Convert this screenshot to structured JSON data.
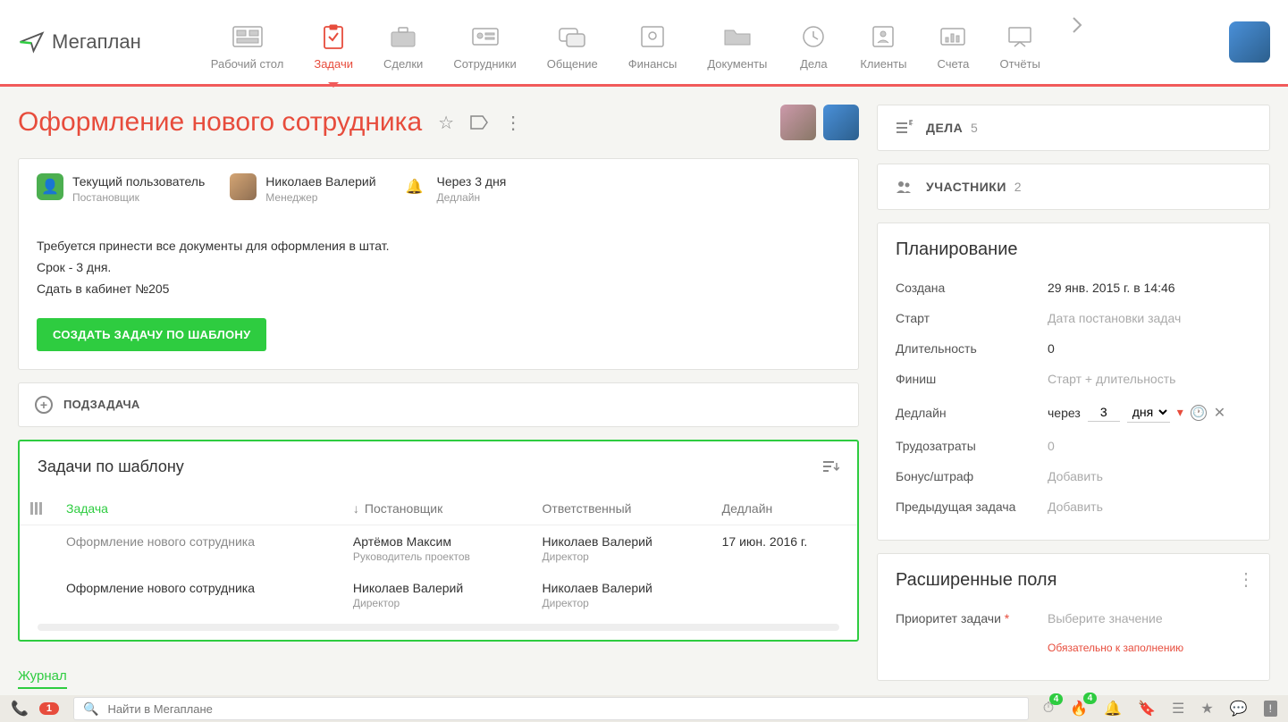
{
  "logo_text": "егаплан",
  "nav": [
    {
      "label": "Рабочий стол"
    },
    {
      "label": "Задачи"
    },
    {
      "label": "Сделки"
    },
    {
      "label": "Сотрудники"
    },
    {
      "label": "Общение"
    },
    {
      "label": "Финансы"
    },
    {
      "label": "Документы"
    },
    {
      "label": "Дела"
    },
    {
      "label": "Клиенты"
    },
    {
      "label": "Счета"
    },
    {
      "label": "Отчёты"
    }
  ],
  "page_title": "Оформление нового сотрудника",
  "task_header": {
    "owner": {
      "name": "Текущий пользователь",
      "role": "Постановщик"
    },
    "manager": {
      "name": "Николаев Валерий",
      "role": "Менеджер"
    },
    "deadline": {
      "value": "Через 3 дня",
      "label": "Дедлайн"
    }
  },
  "task_desc": {
    "l1": "Требуется принести все документы для оформления в штат.",
    "l2": "Срок - 3 дня.",
    "l3": "Сдать в кабинет №205"
  },
  "btn_create": "СОЗДАТЬ ЗАДАЧУ ПО ШАБЛОНУ",
  "subtask_label": "ПОДЗАДАЧА",
  "template": {
    "title": "Задачи по шаблону",
    "cols": {
      "task": "Задача",
      "setter": "Постановщик",
      "resp": "Ответственный",
      "deadline": "Дедлайн"
    },
    "rows": [
      {
        "task": "Оформление нового сотрудника",
        "setter": "Артёмов Максим",
        "setter_role": "Руководитель проектов",
        "resp": "Николаев Валерий",
        "resp_role": "Директор",
        "deadline": "17 июн. 2016 г."
      },
      {
        "task": "Оформление нового сотрудника",
        "setter": "Николаев Валерий",
        "setter_role": "Директор",
        "resp": "Николаев Валерий",
        "resp_role": "Директор",
        "deadline": ""
      }
    ]
  },
  "journal_tab": "Журнал",
  "side": {
    "deals": {
      "label": "ДЕЛА",
      "count": "5"
    },
    "participants": {
      "label": "УЧАСТНИКИ",
      "count": "2"
    }
  },
  "planning": {
    "title": "Планирование",
    "created_l": "Создана",
    "created_v": "29 янв. 2015 г. в 14:46",
    "start_l": "Старт",
    "start_v": "Дата постановки задач",
    "duration_l": "Длительность",
    "duration_v": "0",
    "finish_l": "Финиш",
    "finish_v": "Старт + длительность",
    "deadline_l": "Дедлайн",
    "deadline_prefix": "через",
    "deadline_num": "3",
    "deadline_unit": "дня",
    "effort_l": "Трудозатраты",
    "effort_v": "0",
    "bonus_l": "Бонус/штраф",
    "bonus_v": "Добавить",
    "prev_l": "Предыдущая задача",
    "prev_v": "Добавить"
  },
  "ext": {
    "title": "Расширенные поля",
    "priority_l": "Приоритет задачи",
    "priority_v": "Выберите значение",
    "priority_err": "Обязательно к заполнению"
  },
  "bottombar": {
    "phone_badge": "1",
    "search_placeholder": "Найти в Мегаплане",
    "b1": "4",
    "b2": "4"
  }
}
